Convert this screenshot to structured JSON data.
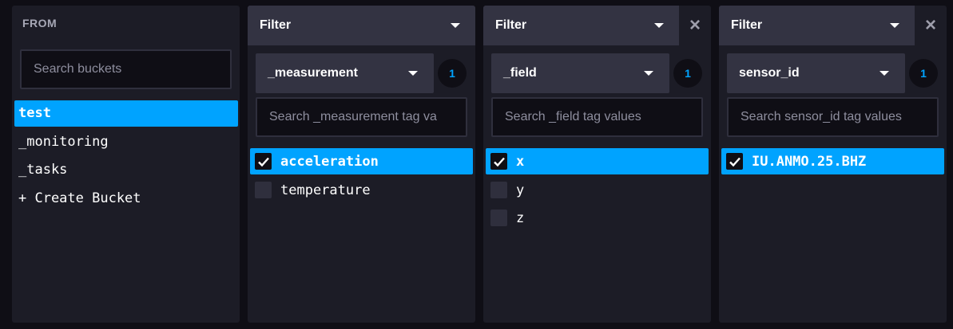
{
  "from": {
    "title": "FROM",
    "search_placeholder": "Search buckets",
    "buckets": [
      {
        "label": "test",
        "selected": true
      },
      {
        "label": "_monitoring",
        "selected": false
      },
      {
        "label": "_tasks",
        "selected": false
      },
      {
        "label": "+ Create Bucket",
        "selected": false
      }
    ]
  },
  "filters": [
    {
      "header_label": "Filter",
      "key": "_measurement",
      "count": "1",
      "search_placeholder": "Search _measurement tag va",
      "values": [
        {
          "label": "acceleration",
          "checked": true
        },
        {
          "label": "temperature",
          "checked": false
        }
      ]
    },
    {
      "header_label": "Filter",
      "key": "_field",
      "count": "1",
      "search_placeholder": "Search _field tag values",
      "values": [
        {
          "label": "x",
          "checked": true
        },
        {
          "label": "y",
          "checked": false
        },
        {
          "label": "z",
          "checked": false
        }
      ]
    },
    {
      "header_label": "Filter",
      "key": "sensor_id",
      "count": "1",
      "search_placeholder": "Search sensor_id tag values",
      "values": [
        {
          "label": "IU.ANMO.25.BHZ",
          "checked": true
        }
      ]
    }
  ],
  "icons": {
    "close": "×"
  },
  "colors": {
    "accent": "#00a3ff",
    "panel": "#1c1c26",
    "header": "#333342",
    "background": "#0f0e15"
  }
}
